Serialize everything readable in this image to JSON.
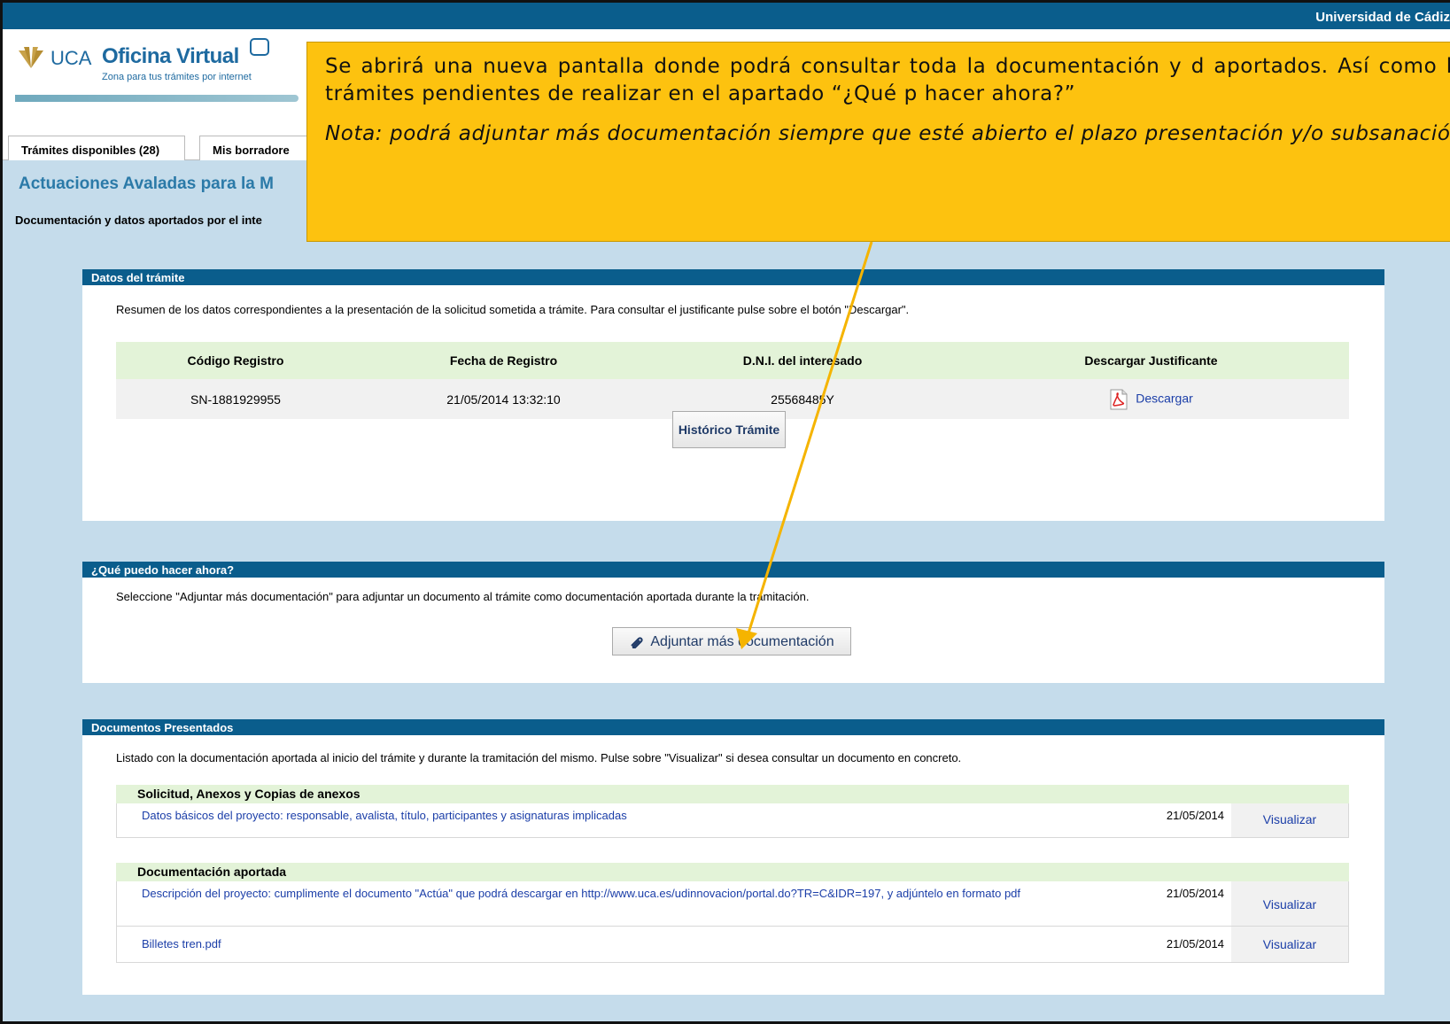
{
  "topbar": {
    "university": "Universidad de Cádiz"
  },
  "logo": {
    "brand_prefix": "UCA",
    "brand_name": "Oficina Virtual",
    "tagline": "Zona para tus trámites por internet"
  },
  "tabs": [
    {
      "label": "Trámites disponibles (28)"
    },
    {
      "label": "Mis borradore"
    }
  ],
  "page": {
    "title": "Actuaciones Avaladas para la M",
    "subtitle": "Documentación y datos aportados por el inte"
  },
  "callout": {
    "text": "Se abrirá una nueva pantalla donde podrá consultar toda la documentación y d aportados. Así como los trámites pendientes de realizar en el apartado “¿Qué p hacer ahora?”",
    "note": "Nota: podrá adjuntar más documentación siempre que esté abierto el plazo presentación y/o subsanación"
  },
  "datos": {
    "header": "Datos del trámite",
    "description": "Resumen de los datos correspondientes a la presentación de la solicitud sometida a trámite. Para consultar el justificante pulse sobre el botón \"Descargar\".",
    "columns": [
      "Código Registro",
      "Fecha de Registro",
      "D.N.I. del interesado",
      "Descargar Justificante"
    ],
    "row": {
      "codigo": "SN-1881929955",
      "fecha": "21/05/2014 13:32:10",
      "dni": "25568485Y",
      "descargar": "Descargar"
    },
    "historico_button": "Histórico Trámite"
  },
  "que_hacer": {
    "header": "¿Qué puedo hacer ahora?",
    "description": "Seleccione \"Adjuntar más documentación\" para adjuntar un documento al trámite como documentación aportada durante la tramitación.",
    "adjuntar_button": "Adjuntar más documentación"
  },
  "documentos": {
    "header": "Documentos Presentados",
    "description": "Listado con la documentación aportada al inicio del trámite y durante la tramitación del mismo. Pulse sobre \"Visualizar\" si desea consultar un documento en concreto.",
    "groups": [
      {
        "title": "Solicitud, Anexos y Copias de anexos",
        "items": [
          {
            "name": "Datos básicos del proyecto: responsable, avalista, título, participantes y asignaturas implicadas",
            "date": "21/05/2014",
            "action": "Visualizar"
          }
        ]
      },
      {
        "title": "Documentación aportada",
        "items": [
          {
            "name": "Descripción del proyecto: cumplimente el documento \"Actúa\" que podrá descargar en http://www.uca.es/udinnovacion/portal.do?TR=C&IDR=197, y adjúntelo en formato pdf",
            "date": "21/05/2014",
            "action": "Visualizar"
          },
          {
            "name": "Billetes tren.pdf",
            "date": "21/05/2014",
            "action": "Visualizar"
          }
        ]
      }
    ]
  },
  "colors": {
    "header_blue": "#0a5d8c",
    "page_bg": "#c5dceb",
    "callout": "#fdc20f",
    "arrow": "#f5b400",
    "table_head": "#e3f3d8"
  }
}
